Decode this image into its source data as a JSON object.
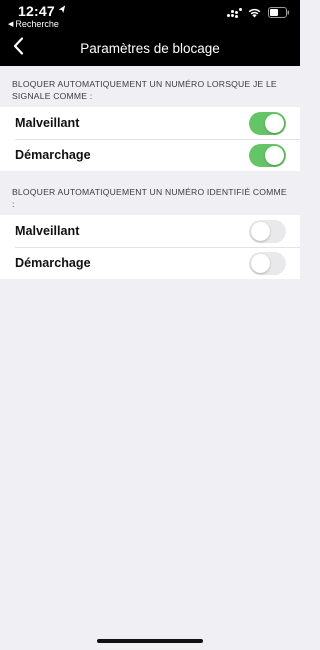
{
  "status_bar": {
    "time": "12:47",
    "location_icon": "location-arrow-icon",
    "back_app_label": "Recherche",
    "icons": [
      "signal-dots-icon",
      "wifi-icon",
      "battery-icon"
    ]
  },
  "nav": {
    "title": "Paramètres de blocage",
    "back_icon": "chevron-left-icon"
  },
  "sections": [
    {
      "header": "BLOQUER AUTOMATIQUEMENT UN NUMÉRO LORSQUE JE LE SIGNALE COMME :",
      "rows": [
        {
          "label": "Malveillant",
          "enabled": true
        },
        {
          "label": "Démarchage",
          "enabled": true
        }
      ]
    },
    {
      "header": "BLOQUER AUTOMATIQUEMENT UN NUMÉRO IDENTIFIÉ COMME :",
      "rows": [
        {
          "label": "Malveillant",
          "enabled": false
        },
        {
          "label": "Démarchage",
          "enabled": false
        }
      ]
    }
  ],
  "colors": {
    "toggle_on": "#65c466",
    "toggle_off": "#e9e9eb",
    "background": "#efeff4",
    "header_bar": "#000000"
  }
}
